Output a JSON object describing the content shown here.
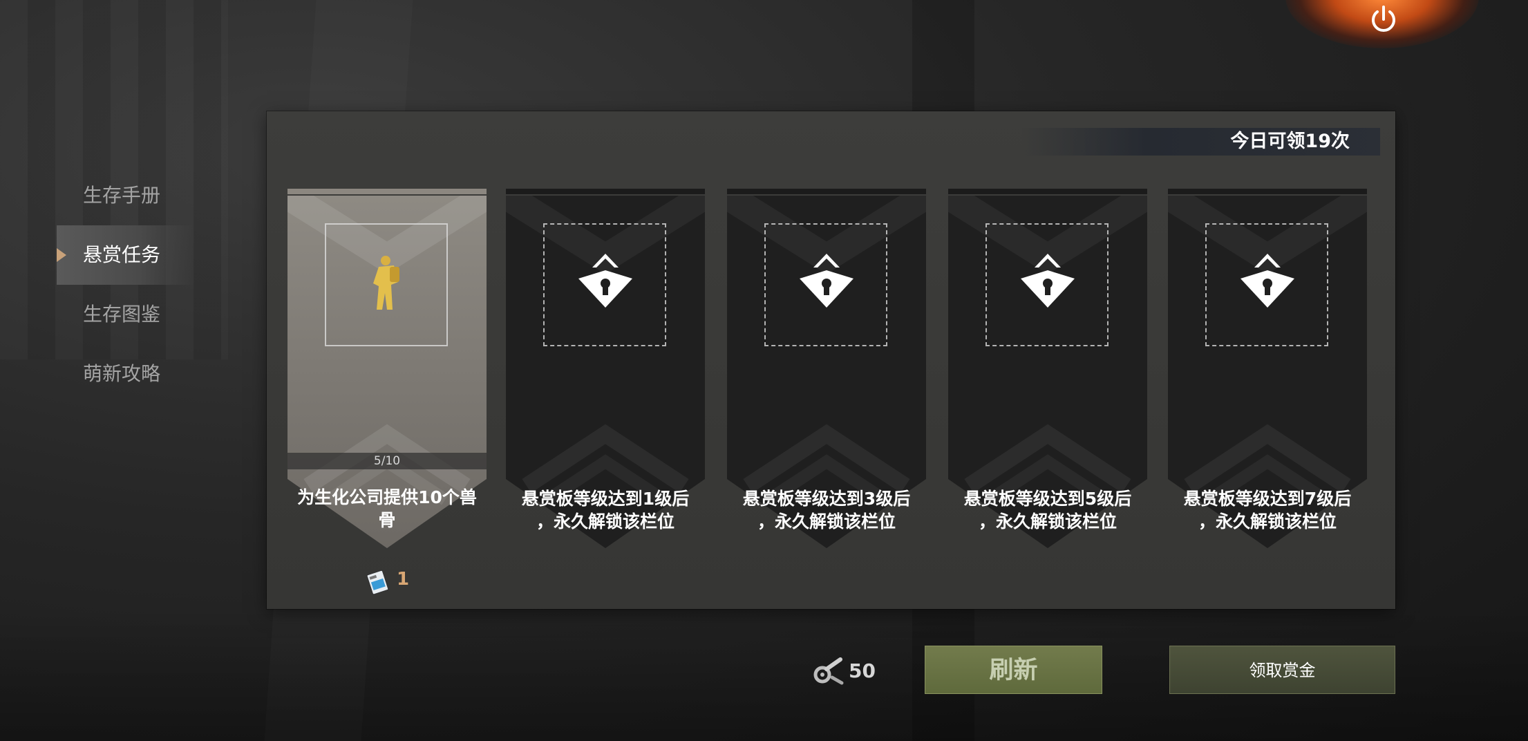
{
  "menu": {
    "items": [
      {
        "label": "生存手册",
        "active": false
      },
      {
        "label": "悬赏任务",
        "active": true
      },
      {
        "label": "生存图鉴",
        "active": false
      },
      {
        "label": "萌新攻略",
        "active": false
      }
    ]
  },
  "panel": {
    "today_text": "今日可领19次",
    "slots": [
      {
        "state": "active",
        "icon": "survivor-figure-icon",
        "progress": "5/10",
        "desc_line1": "为生化公司提供10个兽",
        "desc_line2": "骨",
        "reward_icon": "blue-card-icon",
        "reward_count": "1"
      },
      {
        "state": "locked",
        "icon": "lock-icon",
        "desc_line1": "悬赏板等级达到1级后",
        "desc_line2": "，永久解锁该栏位"
      },
      {
        "state": "locked",
        "icon": "lock-icon",
        "desc_line1": "悬赏板等级达到3级后",
        "desc_line2": "，永久解锁该栏位"
      },
      {
        "state": "locked",
        "icon": "lock-icon",
        "desc_line1": "悬赏板等级达到5级后",
        "desc_line2": "，永久解锁该栏位"
      },
      {
        "state": "locked",
        "icon": "lock-icon",
        "desc_line1": "悬赏板等级达到7级后",
        "desc_line2": "，永久解锁该栏位"
      }
    ]
  },
  "actions": {
    "refresh_cost": "50",
    "refresh_cost_icon": "parts-icon",
    "refresh_label": "刷新",
    "claim_label": "领取赏金"
  },
  "power_icon": "power-icon",
  "colors": {
    "refresh_green": "#6a7444",
    "claim_olive": "#474c37",
    "reward_orange": "#d9a774",
    "active_arrow": "#c9a27a"
  }
}
